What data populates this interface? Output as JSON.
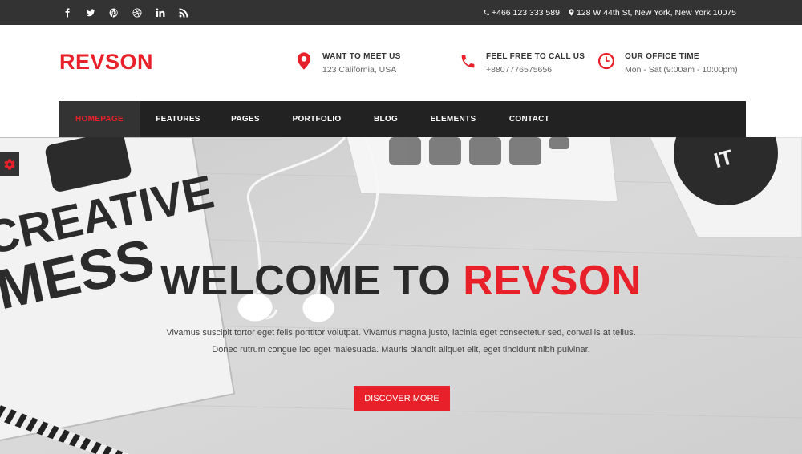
{
  "colors": {
    "accent": "#e8202a",
    "topbar": "#333333",
    "nav": "#222222",
    "nav_active": "#333333"
  },
  "topbar": {
    "social": [
      {
        "icon": "facebook-icon"
      },
      {
        "icon": "twitter-icon"
      },
      {
        "icon": "pinterest-icon"
      },
      {
        "icon": "dribbble-icon"
      },
      {
        "icon": "linkedin-icon"
      },
      {
        "icon": "rss-icon"
      }
    ],
    "phone": "+466 123 333 589",
    "address": "128 W 44th St, New York, New York 10075"
  },
  "header": {
    "logo": "REVSON",
    "info": [
      {
        "icon": "map-marker-icon",
        "title": "WANT TO MEET US",
        "sub": "123 California, USA"
      },
      {
        "icon": "phone-icon",
        "title": "FEEL FREE TO CALL US",
        "sub": "+8807776575656"
      },
      {
        "icon": "clock-icon",
        "title": "OUR OFFICE TIME",
        "sub": "Mon - Sat (9:00am - 10:00pm)"
      }
    ]
  },
  "nav": {
    "items": [
      {
        "label": "HOMEPAGE",
        "active": true
      },
      {
        "label": "FEATURES"
      },
      {
        "label": "PAGES"
      },
      {
        "label": "PORTFOLIO"
      },
      {
        "label": "BLOG"
      },
      {
        "label": "ELEMENTS"
      },
      {
        "label": "CONTACT"
      }
    ]
  },
  "hero": {
    "title_main": "WELCOME TO ",
    "title_accent": "REVSON",
    "text_line1": "Vivamus suscipit tortor eget felis porttitor volutpat. Vivamus magna justo, lacinia eget consectetur sed, convallis at tellus.",
    "text_line2": "Donec rutrum congue leo eget malesuada. Mauris blandit aliquet elit, eget tincidunt nibh pulvinar.",
    "button": "DISCOVER MORE",
    "bg_text": {
      "book_line1": "CREATIVE",
      "book_line2": "MESS",
      "badge": "IT"
    }
  }
}
